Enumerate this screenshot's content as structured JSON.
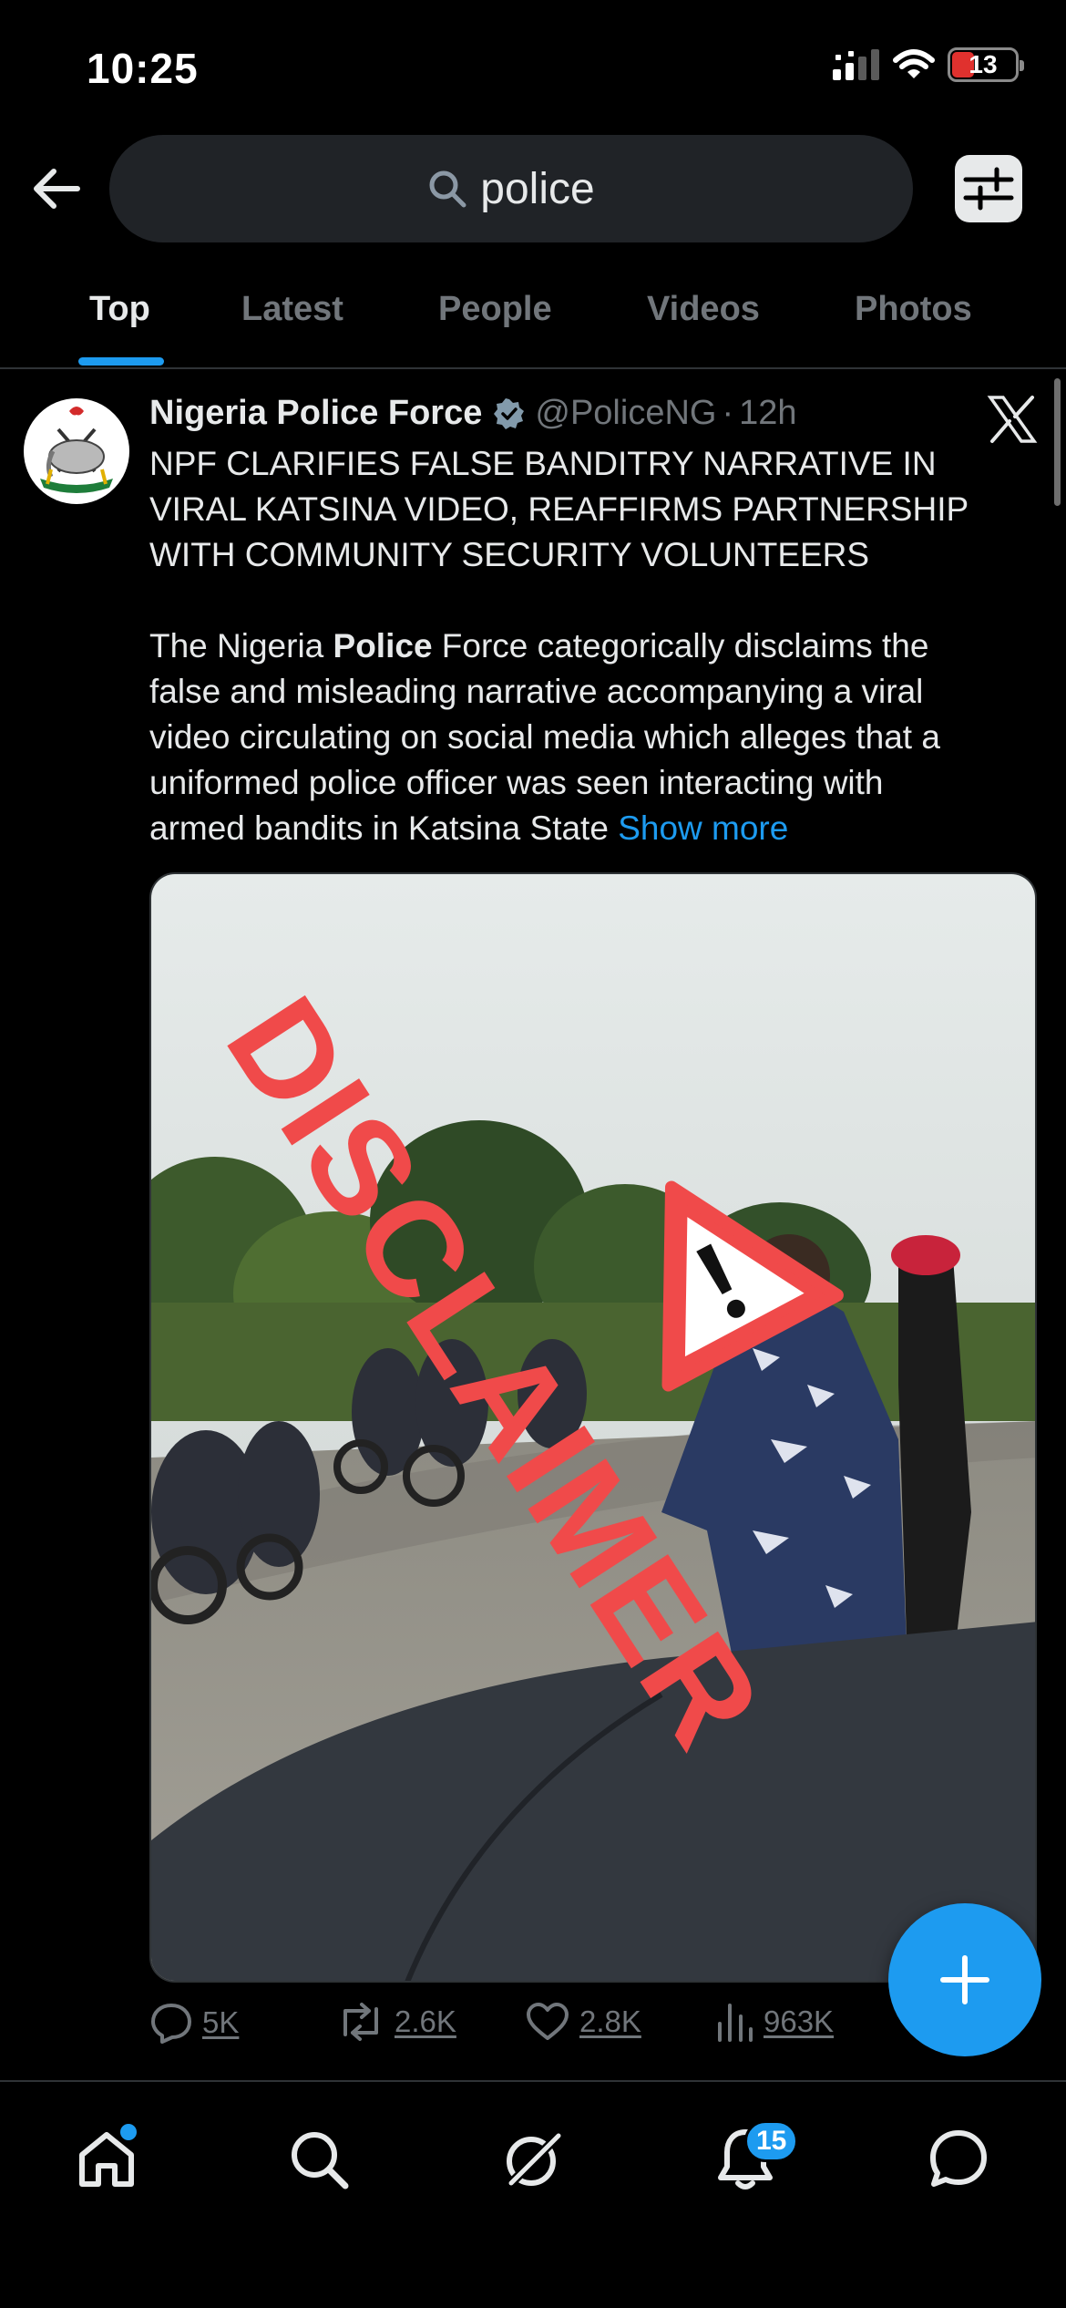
{
  "status_bar": {
    "time": "10:25",
    "battery": "13"
  },
  "search": {
    "query": "police"
  },
  "tabs": [
    {
      "label": "Top",
      "active": true
    },
    {
      "label": "Latest",
      "active": false
    },
    {
      "label": "People",
      "active": false
    },
    {
      "label": "Videos",
      "active": false
    },
    {
      "label": "Photos",
      "active": false
    }
  ],
  "tweet": {
    "author_name": "Nigeria Police Force",
    "handle": "@PoliceNG",
    "separator": "·",
    "time": "12h",
    "avatar_text": "NIGERIA",
    "title_lines": [
      "NPF CLARIFIES FALSE BANDITRY NARRATIVE IN",
      "VIRAL KATSINA VIDEO, REAFFIRMS PARTNERSHIP",
      "WITH COMMUNITY SECURITY VOLUNTEERS"
    ],
    "body_lines": [
      {
        "before": "The Nigeria ",
        "bold": "Police",
        "after": " Force categorically disclaims the"
      },
      {
        "text": "false and misleading narrative accompanying a viral"
      },
      {
        "text": "video circulating on social media which alleges that a"
      },
      {
        "text": "uniformed police officer was seen interacting with"
      },
      {
        "text": "armed bandits in Katsina State ",
        "link": "Show more"
      }
    ],
    "media_overlay_text": "DISCLAIMER",
    "stats": {
      "replies": "5K",
      "reposts": "2.6K",
      "likes": "2.8K",
      "views": "963K"
    }
  },
  "bottom_nav": {
    "notification_count": "15"
  },
  "colors": {
    "accent": "#1d9bf0",
    "muted": "#71767b",
    "overlay_red": "#f04a4a"
  },
  "icons": [
    "back-arrow-icon",
    "search-icon",
    "filter-icon",
    "verified-badge-icon",
    "x-logo-icon",
    "reply-icon",
    "repost-icon",
    "like-icon",
    "views-icon",
    "compose-plus-icon",
    "home-icon",
    "search-nav-icon",
    "grok-icon",
    "bell-icon",
    "messages-icon"
  ]
}
